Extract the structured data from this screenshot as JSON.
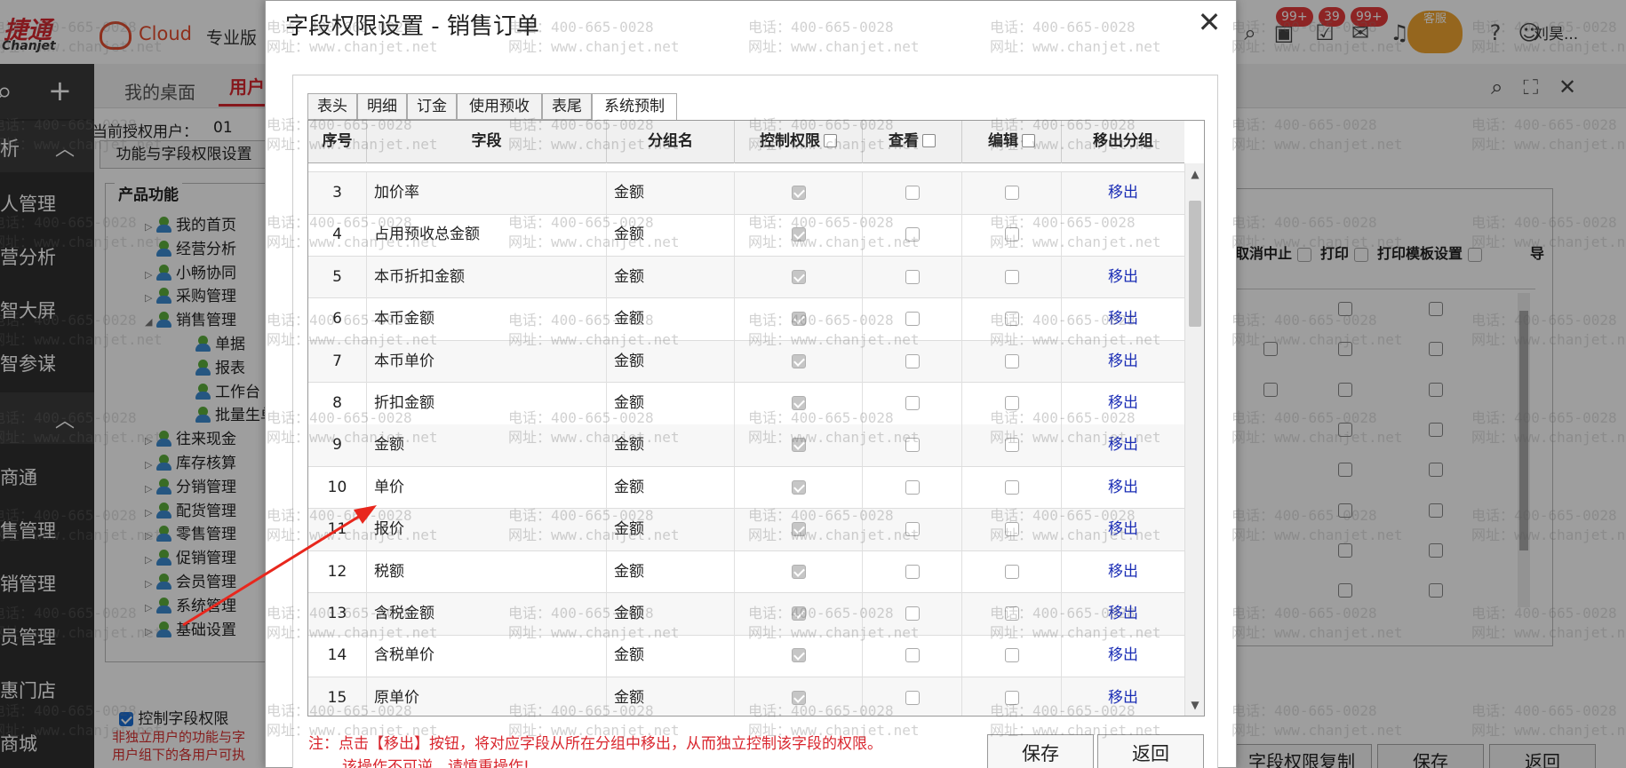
{
  "topbar": {
    "logo_main": "捷通",
    "logo_sub": "Chanjet",
    "cloud": "Cloud",
    "edition": "专业版",
    "badges": [
      "99+",
      "39",
      "99+"
    ],
    "kefu": "客服",
    "user": "刘昊..."
  },
  "sidebar": {
    "sections": [
      {
        "label": "析"
      },
      {
        "label": ""
      }
    ],
    "items": [
      "人管理",
      "营分析",
      "智大屏",
      "智参谋",
      "商通",
      "售管理",
      "销管理",
      "员管理",
      "惠门店",
      "商城"
    ]
  },
  "background": {
    "tabs": [
      "我的桌面",
      "用户"
    ],
    "current_user_label": "当前授权用户：",
    "current_user_value": "01",
    "func_button": "功能与字段权限设置",
    "tree_legend": "产品功能",
    "tree": [
      {
        "label": "我的首页",
        "level": 1,
        "arrow": true
      },
      {
        "label": "经营分析",
        "level": 1,
        "arrow": false
      },
      {
        "label": "小畅协同",
        "level": 1,
        "arrow": true
      },
      {
        "label": "采购管理",
        "level": 1,
        "arrow": true
      },
      {
        "label": "销售管理",
        "level": 1,
        "arrow": true,
        "open": true
      },
      {
        "label": "单据",
        "level": 2,
        "arrow": false
      },
      {
        "label": "报表",
        "level": 2,
        "arrow": false
      },
      {
        "label": "工作台",
        "level": 2,
        "arrow": false
      },
      {
        "label": "批量生单",
        "level": 2,
        "arrow": false
      },
      {
        "label": "往来现金",
        "level": 1,
        "arrow": true
      },
      {
        "label": "库存核算",
        "level": 1,
        "arrow": true
      },
      {
        "label": "分销管理",
        "level": 1,
        "arrow": true
      },
      {
        "label": "配货管理",
        "level": 1,
        "arrow": true
      },
      {
        "label": "零售管理",
        "level": 1,
        "arrow": true
      },
      {
        "label": "促销管理",
        "level": 1,
        "arrow": true
      },
      {
        "label": "会员管理",
        "level": 1,
        "arrow": true
      },
      {
        "label": "系统管理",
        "level": 1,
        "arrow": true
      },
      {
        "label": "基础设置",
        "level": 1,
        "arrow": true
      }
    ],
    "control_field": "控制字段权限",
    "note_lines": [
      "非独立用户的功能与字",
      "用户组下的各用户可执"
    ],
    "right_headers": [
      "取消中止",
      "打印",
      "打印模板设置",
      "导"
    ],
    "buttons": [
      "字段权限复制",
      "保存",
      "返回"
    ]
  },
  "watermark": {
    "phone": "电话：400-665-0028",
    "site": "网址：www.chanjet.net"
  },
  "dialog": {
    "title": "字段权限设置 - 销售订单",
    "close": "✕",
    "tabs": [
      "表头",
      "明细",
      "订金",
      "使用预收",
      "表尾",
      "系统预制"
    ],
    "active_tab": 5,
    "columns": {
      "no": "序号",
      "field": "字段",
      "group": "分组名",
      "control": "控制权限",
      "view": "查看",
      "edit": "编辑",
      "move": "移出分组"
    },
    "rows": [
      {
        "no": "3",
        "field": "加价率",
        "group": "金额",
        "move": "移出"
      },
      {
        "no": "4",
        "field": "占用预收总金额",
        "group": "金额",
        "move": ""
      },
      {
        "no": "5",
        "field": "本币折扣金额",
        "group": "金额",
        "move": "移出"
      },
      {
        "no": "6",
        "field": "本币金额",
        "group": "金额",
        "move": "移出"
      },
      {
        "no": "7",
        "field": "本币单价",
        "group": "金额",
        "move": "移出"
      },
      {
        "no": "8",
        "field": "折扣金额",
        "group": "金额",
        "move": "移出"
      },
      {
        "no": "9",
        "field": "金额",
        "group": "金额",
        "move": "移出"
      },
      {
        "no": "10",
        "field": "单价",
        "group": "金额",
        "move": "移出"
      },
      {
        "no": "11",
        "field": "报价",
        "group": "金额",
        "move": "移出"
      },
      {
        "no": "12",
        "field": "税额",
        "group": "金额",
        "move": "移出"
      },
      {
        "no": "13",
        "field": "含税金额",
        "group": "金额",
        "move": "移出"
      },
      {
        "no": "14",
        "field": "含税单价",
        "group": "金额",
        "move": "移出"
      },
      {
        "no": "15",
        "field": "原单价",
        "group": "金额",
        "move": "移出"
      }
    ],
    "note_line1": "注：点击【移出】按钮，将对应字段从所在分组中移出，从而独立控制该字段的权限。",
    "note_line2": "该操作不可逆，请慎重操作!",
    "save": "保存",
    "back": "返回"
  },
  "colors": {
    "accent_red": "#d9262e",
    "link_blue": "#1a2db5",
    "sidebar_bg": "#2f2f2f"
  }
}
